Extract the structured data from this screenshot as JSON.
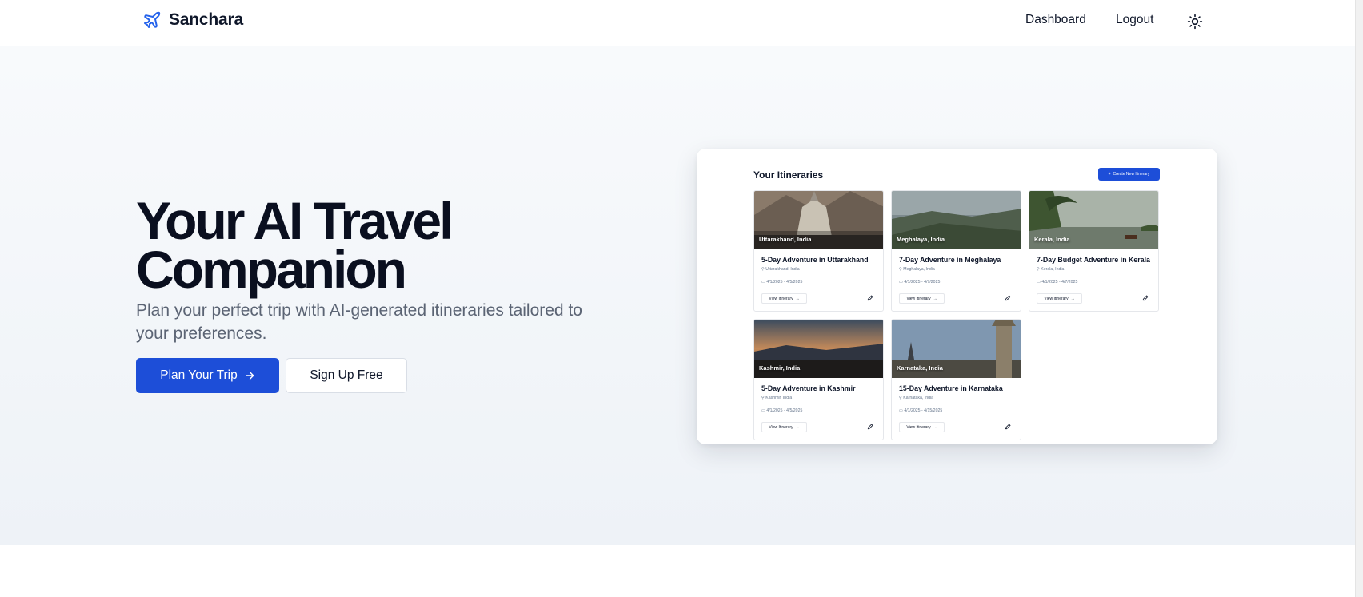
{
  "header": {
    "brand": "Sanchara",
    "brand_icon": "plane-icon",
    "nav": {
      "dashboard": "Dashboard",
      "logout": "Logout"
    },
    "theme_icon": "sun-icon"
  },
  "hero": {
    "title": "Your AI Travel Companion",
    "subtitle": "Plan your perfect trip with AI-generated itineraries tailored to your preferences.",
    "primary_button": "Plan Your Trip",
    "secondary_button": "Sign Up Free"
  },
  "preview": {
    "title": "Your Itineraries",
    "create_button": "Create New Itinerary",
    "view_button": "View Itinerary",
    "cards": [
      {
        "location": "Uttarakhand, India",
        "title": "5-Day Adventure in Uttarakhand",
        "region": "Uttarakhand, India",
        "dates": "4/1/2025 - 4/5/2025"
      },
      {
        "location": "Meghalaya, India",
        "title": "7-Day Adventure in Meghalaya",
        "region": "Meghalaya, India",
        "dates": "4/1/2025 - 4/7/2025"
      },
      {
        "location": "Kerala, India",
        "title": "7-Day Budget Adventure in Kerala",
        "region": "Kerala, India",
        "dates": "4/1/2025 - 4/7/2025"
      },
      {
        "location": "Kashmir, India",
        "title": "5-Day Adventure in Kashmir",
        "region": "Kashmir, India",
        "dates": "4/1/2025 - 4/5/2025"
      },
      {
        "location": "Karnataka, India",
        "title": "15-Day Adventure in Karnataka",
        "region": "Karnataka, India",
        "dates": "4/1/2025 - 4/15/2025"
      }
    ]
  },
  "colors": {
    "accent": "#1d4ed8",
    "text": "#0f172a",
    "muted": "#5b6474"
  }
}
